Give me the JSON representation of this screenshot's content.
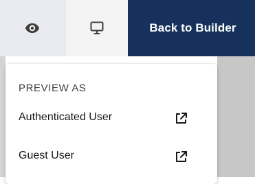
{
  "toolbar": {
    "preview_icon": "eye-icon",
    "device_icon": "desktop-monitor-icon",
    "back_label": "Back to Builder",
    "colors": {
      "back_bg": "#16325c",
      "preview_bg": "#e9ebf0",
      "device_bg": "#f3f3f3",
      "icon_color": "#3e3e3c"
    }
  },
  "dropdown": {
    "heading": "PREVIEW AS",
    "items": [
      {
        "label": "Authenticated User",
        "icon": "external-link-icon"
      },
      {
        "label": "Guest User",
        "icon": "external-link-icon"
      }
    ]
  }
}
